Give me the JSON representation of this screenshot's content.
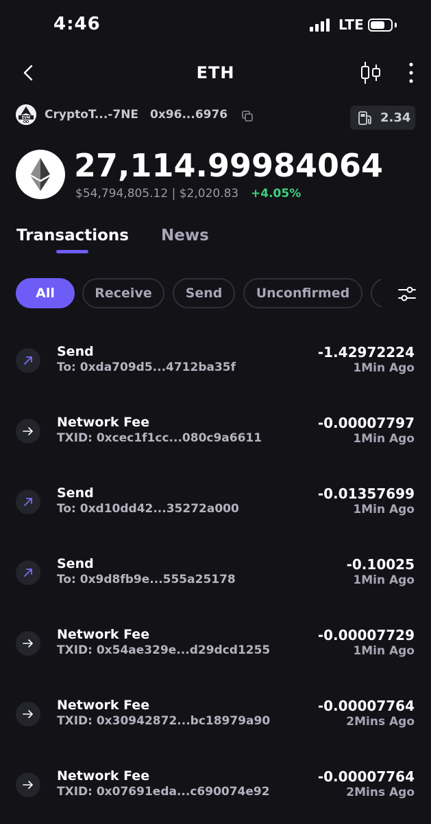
{
  "status_bar": {
    "time": "4:46",
    "network": "LTE"
  },
  "header": {
    "title": "ETH"
  },
  "wallet": {
    "logo_text": "EVM",
    "name": "CryptoT...-7NE",
    "address": "0x96...6976",
    "gas_value": "2.34"
  },
  "balance": {
    "amount": "27,114.99984064",
    "fiat_line": "$54,794,805.12 | $2,020.83",
    "change": "+4.05%"
  },
  "tabs": [
    {
      "label": "Transactions",
      "active": true
    },
    {
      "label": "News",
      "active": false
    }
  ],
  "filters": [
    {
      "label": "All",
      "active": true
    },
    {
      "label": "Receive",
      "active": false
    },
    {
      "label": "Send",
      "active": false
    },
    {
      "label": "Unconfirmed",
      "active": false
    }
  ],
  "transactions": [
    {
      "type": "Send",
      "detail": "To: 0xda709d5...4712ba35f",
      "amount": "-1.42972224",
      "time": "1Min Ago",
      "icon": "arrow-up-right-icon"
    },
    {
      "type": "Network Fee",
      "detail": "TXID: 0xcec1f1cc...080c9a6611",
      "amount": "-0.00007797",
      "time": "1Min Ago",
      "icon": "arrow-right-icon"
    },
    {
      "type": "Send",
      "detail": "To: 0xd10dd42...35272a000",
      "amount": "-0.01357699",
      "time": "1Min Ago",
      "icon": "arrow-up-right-icon"
    },
    {
      "type": "Send",
      "detail": "To: 0x9d8fb9e...555a25178",
      "amount": "-0.10025",
      "time": "1Min Ago",
      "icon": "arrow-up-right-icon"
    },
    {
      "type": "Network Fee",
      "detail": "TXID: 0x54ae329e...d29dcd1255",
      "amount": "-0.00007729",
      "time": "1Min Ago",
      "icon": "arrow-right-icon"
    },
    {
      "type": "Network Fee",
      "detail": "TXID: 0x30942872...bc18979a90",
      "amount": "-0.00007764",
      "time": "2Mins Ago",
      "icon": "arrow-right-icon"
    },
    {
      "type": "Network Fee",
      "detail": "TXID: 0x07691eda...c690074e92",
      "amount": "-0.00007764",
      "time": "2Mins Ago",
      "icon": "arrow-right-icon"
    }
  ],
  "colors": {
    "background": "#121217",
    "accent": "#6e5cf6",
    "positive": "#3fd17f",
    "muted": "#a6a6b6"
  }
}
